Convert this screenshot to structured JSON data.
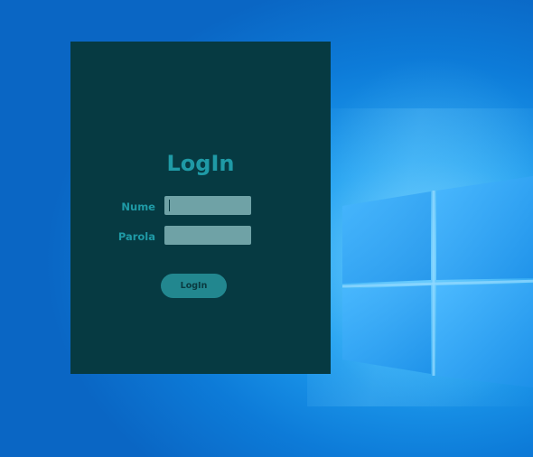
{
  "login": {
    "title": "LogIn",
    "username_label": "Nume",
    "username_value": "",
    "password_label": "Parola",
    "password_value": "",
    "submit_label": "LogIn"
  },
  "colors": {
    "window_bg": "#063a42",
    "accent_text": "#1f9aa6",
    "input_bg": "#6fa2a6",
    "button_bg": "#22878f",
    "desktop_blue": "#0d7bd8"
  }
}
